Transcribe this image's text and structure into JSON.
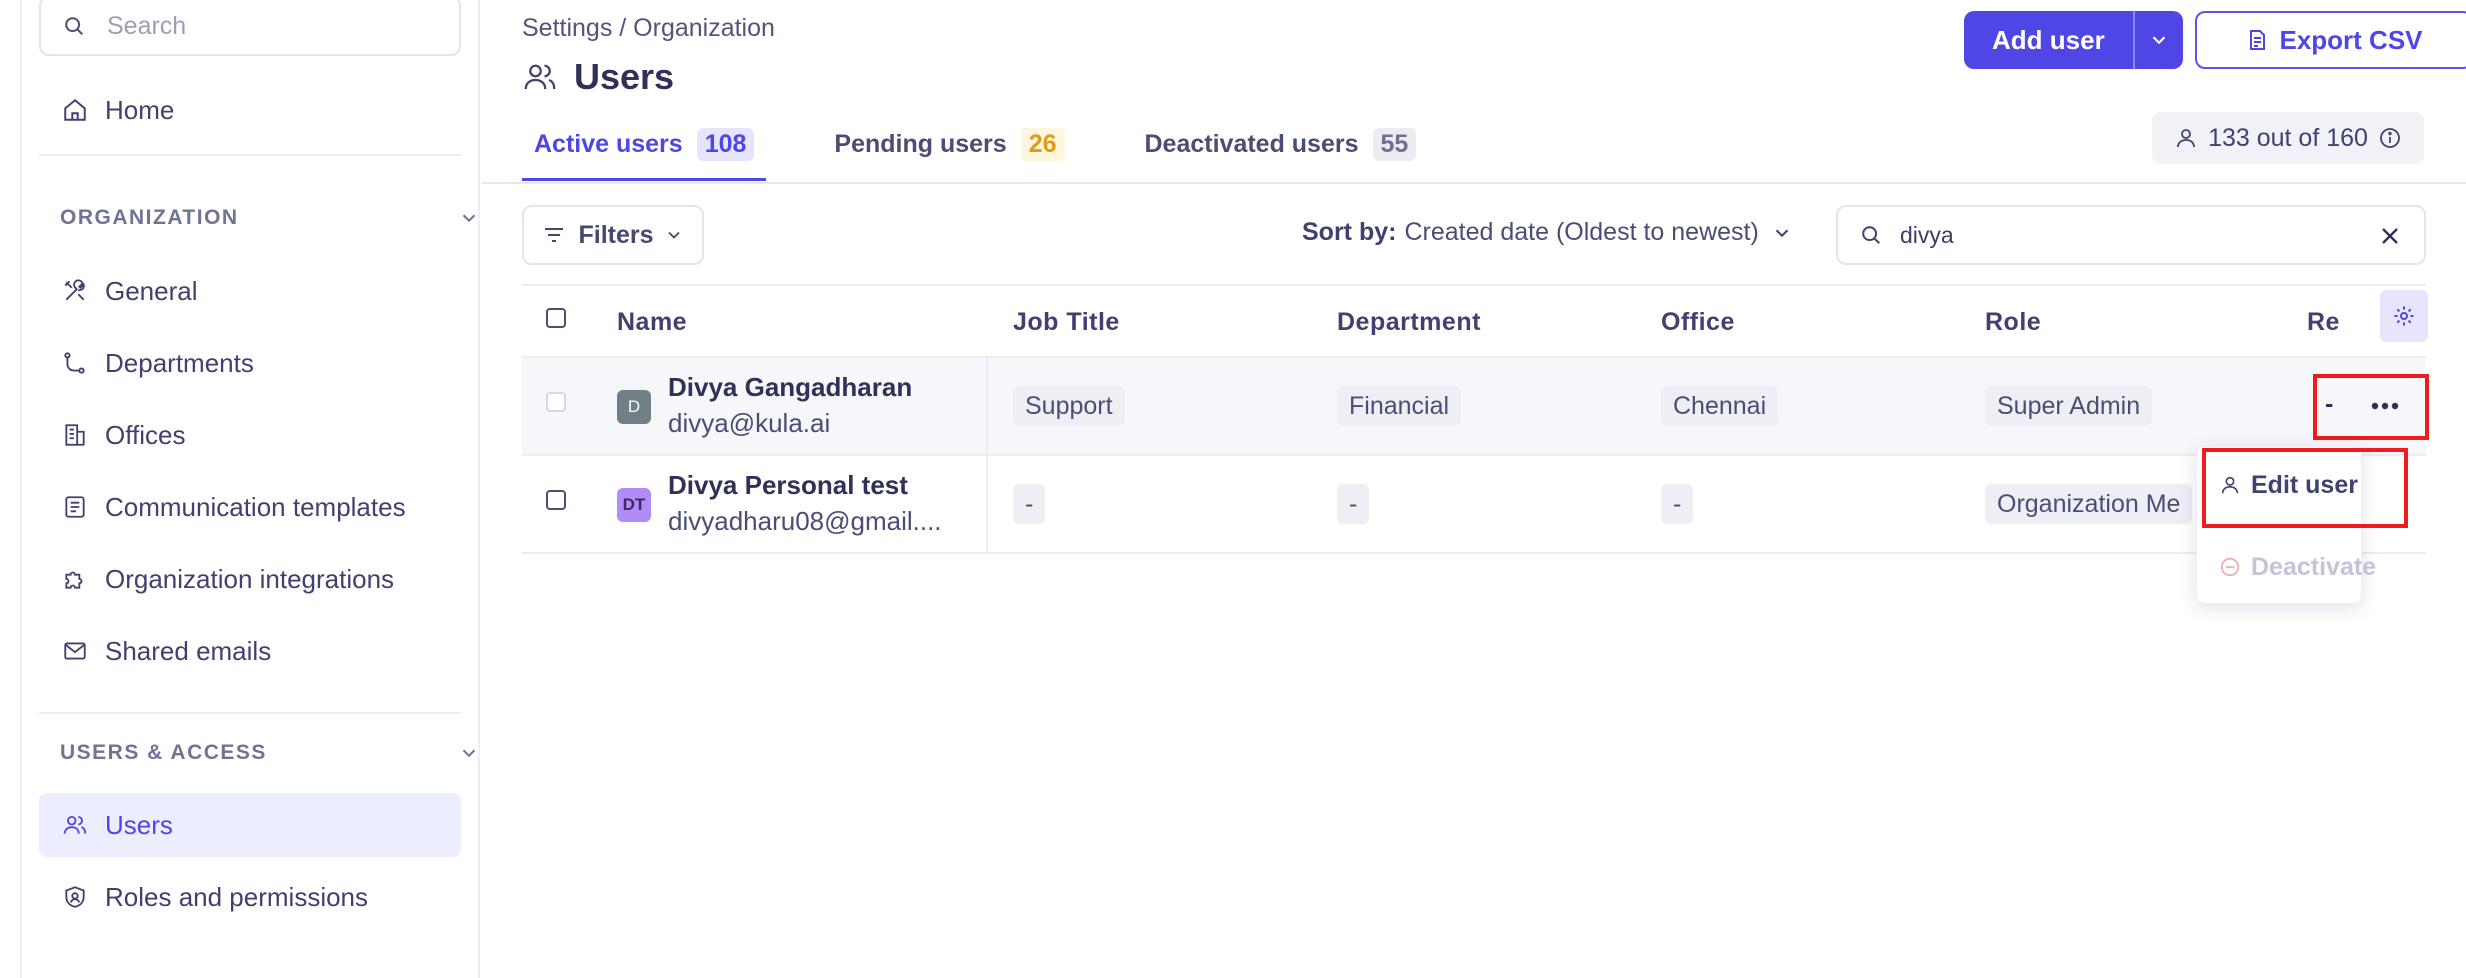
{
  "sidebar": {
    "search_placeholder": "Search",
    "home_label": "Home",
    "organization_header": "ORGANIZATION",
    "organization_items": [
      {
        "label": "General",
        "icon": "tools-icon"
      },
      {
        "label": "Departments",
        "icon": "tree-icon"
      },
      {
        "label": "Offices",
        "icon": "building-icon"
      },
      {
        "label": "Communication templates",
        "icon": "template-icon"
      },
      {
        "label": "Organization integrations",
        "icon": "puzzle-icon"
      },
      {
        "label": "Shared emails",
        "icon": "mail-icon"
      }
    ],
    "users_access_header": "USERS & ACCESS",
    "users_access_items": [
      {
        "label": "Users",
        "icon": "users-icon",
        "active": true
      },
      {
        "label": "Roles and permissions",
        "icon": "shield-icon"
      }
    ]
  },
  "header": {
    "breadcrumb": "Settings / Organization",
    "title": "Users",
    "add_user_label": "Add user",
    "export_label": "Export CSV",
    "seat_count": "133 out of 160"
  },
  "tabs": [
    {
      "label": "Active users",
      "count": "108",
      "active": true
    },
    {
      "label": "Pending users",
      "count": "26"
    },
    {
      "label": "Deactivated users",
      "count": "55"
    }
  ],
  "toolbar": {
    "filters_label": "Filters",
    "sort_label": "Sort by:",
    "sort_value": "Created date (Oldest to newest)",
    "search_value": "divya"
  },
  "table": {
    "columns": [
      "Name",
      "Job Title",
      "Department",
      "Office",
      "Role",
      "Re"
    ],
    "rows": [
      {
        "initials": "D",
        "name": "Divya Gangadharan",
        "email": "divya@kula.ai",
        "job_title": "Support",
        "department": "Financial",
        "office": "Chennai",
        "role": "Super Admin",
        "reports_to": "-"
      },
      {
        "initials": "DT",
        "name": "Divya Personal test",
        "email": "divyadharu08@gmail....",
        "job_title": "-",
        "department": "-",
        "office": "-",
        "role": "Organization Me"
      }
    ]
  },
  "row_menu": {
    "edit_label": "Edit user",
    "deactivate_label": "Deactivate"
  },
  "colors": {
    "accent": "#4f46e5",
    "highlight_box": "#ee1c1c",
    "pending_badge": "#e29b12"
  }
}
